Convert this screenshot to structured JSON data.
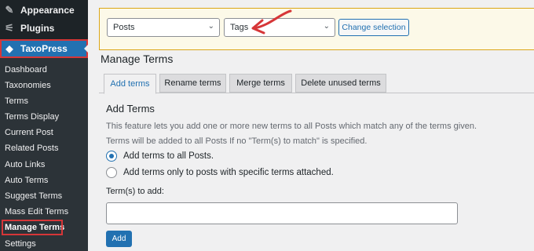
{
  "sidebar": {
    "top_items": [
      {
        "label": "Appearance",
        "icon": "paintbrush-icon"
      },
      {
        "label": "Plugins",
        "icon": "plug-icon"
      }
    ],
    "active_menu": {
      "label": "TaxoPress",
      "icon": "tag-icon"
    },
    "submenu": [
      {
        "label": "Dashboard"
      },
      {
        "label": "Taxonomies"
      },
      {
        "label": "Terms"
      },
      {
        "label": "Terms Display"
      },
      {
        "label": "Current Post"
      },
      {
        "label": "Related Posts"
      },
      {
        "label": "Auto Links"
      },
      {
        "label": "Auto Terms"
      },
      {
        "label": "Suggest Terms"
      },
      {
        "label": "Mass Edit Terms"
      },
      {
        "label": "Manage Terms"
      },
      {
        "label": "Settings"
      }
    ],
    "current_submenu": "Manage Terms"
  },
  "selector_bar": {
    "post_type_value": "Posts",
    "taxonomy_value": "Tags",
    "change_button": "Change selection",
    "colors": {
      "background": "#fcf9e8",
      "border": "#dba617"
    }
  },
  "page": {
    "title": "Manage Terms"
  },
  "tabs": [
    {
      "label": "Add terms",
      "active": true
    },
    {
      "label": "Rename terms",
      "active": false
    },
    {
      "label": "Merge terms",
      "active": false
    },
    {
      "label": "Delete unused terms",
      "active": false
    }
  ],
  "content": {
    "section_title": "Add Terms",
    "description_1": "This feature lets you add one or more new terms to all Posts which match any of the terms given.",
    "description_2": "Terms will be added to all Posts If no \"Term(s) to match\" is specified.",
    "radio_options": [
      {
        "label": "Add terms to all Posts.",
        "checked": true
      },
      {
        "label": "Add terms only to posts with specific terms attached.",
        "checked": false
      }
    ],
    "terms_field_label": "Term(s) to add:",
    "terms_field_value": "",
    "submit_button": "Add"
  },
  "colors": {
    "accent": "#2271b1",
    "sidebar_bg": "#1d2327",
    "submenu_bg": "#2c3338",
    "highlight_red": "#d63638"
  }
}
